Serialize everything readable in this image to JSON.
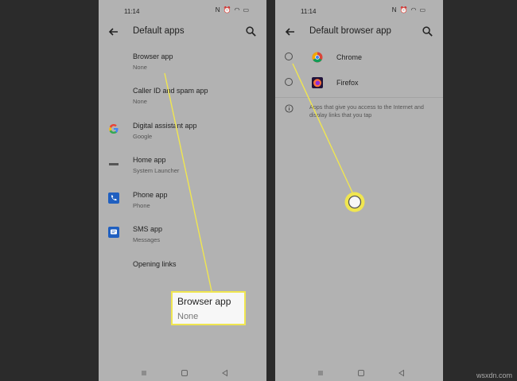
{
  "left_screen": {
    "status_time": "11:14",
    "title": "Default apps",
    "items": [
      {
        "title": "Browser app",
        "subtitle": "None"
      },
      {
        "title": "Caller ID and spam app",
        "subtitle": "None"
      },
      {
        "title": "Digital assistant app",
        "subtitle": "Google",
        "icon": "google-icon"
      },
      {
        "title": "Home app",
        "subtitle": "System Launcher",
        "icon": "launcher-icon"
      },
      {
        "title": "Phone app",
        "subtitle": "Phone",
        "icon": "phone-icon"
      },
      {
        "title": "SMS app",
        "subtitle": "Messages",
        "icon": "messages-icon"
      },
      {
        "title": "Opening links"
      }
    ]
  },
  "right_screen": {
    "status_time": "11:14",
    "title": "Default browser app",
    "options": [
      {
        "name": "Chrome",
        "icon": "chrome-icon"
      },
      {
        "name": "Firefox",
        "icon": "firefox-icon"
      }
    ],
    "info": "Apps that give you access to the Internet and display links that you tap"
  },
  "callout": {
    "title": "Browser app",
    "subtitle": "None"
  },
  "watermark": "wsxdn.com",
  "colors": {
    "highlight": "#f0e650",
    "screen_bg": "#b2b2b2",
    "frame": "#2b2b2b"
  }
}
